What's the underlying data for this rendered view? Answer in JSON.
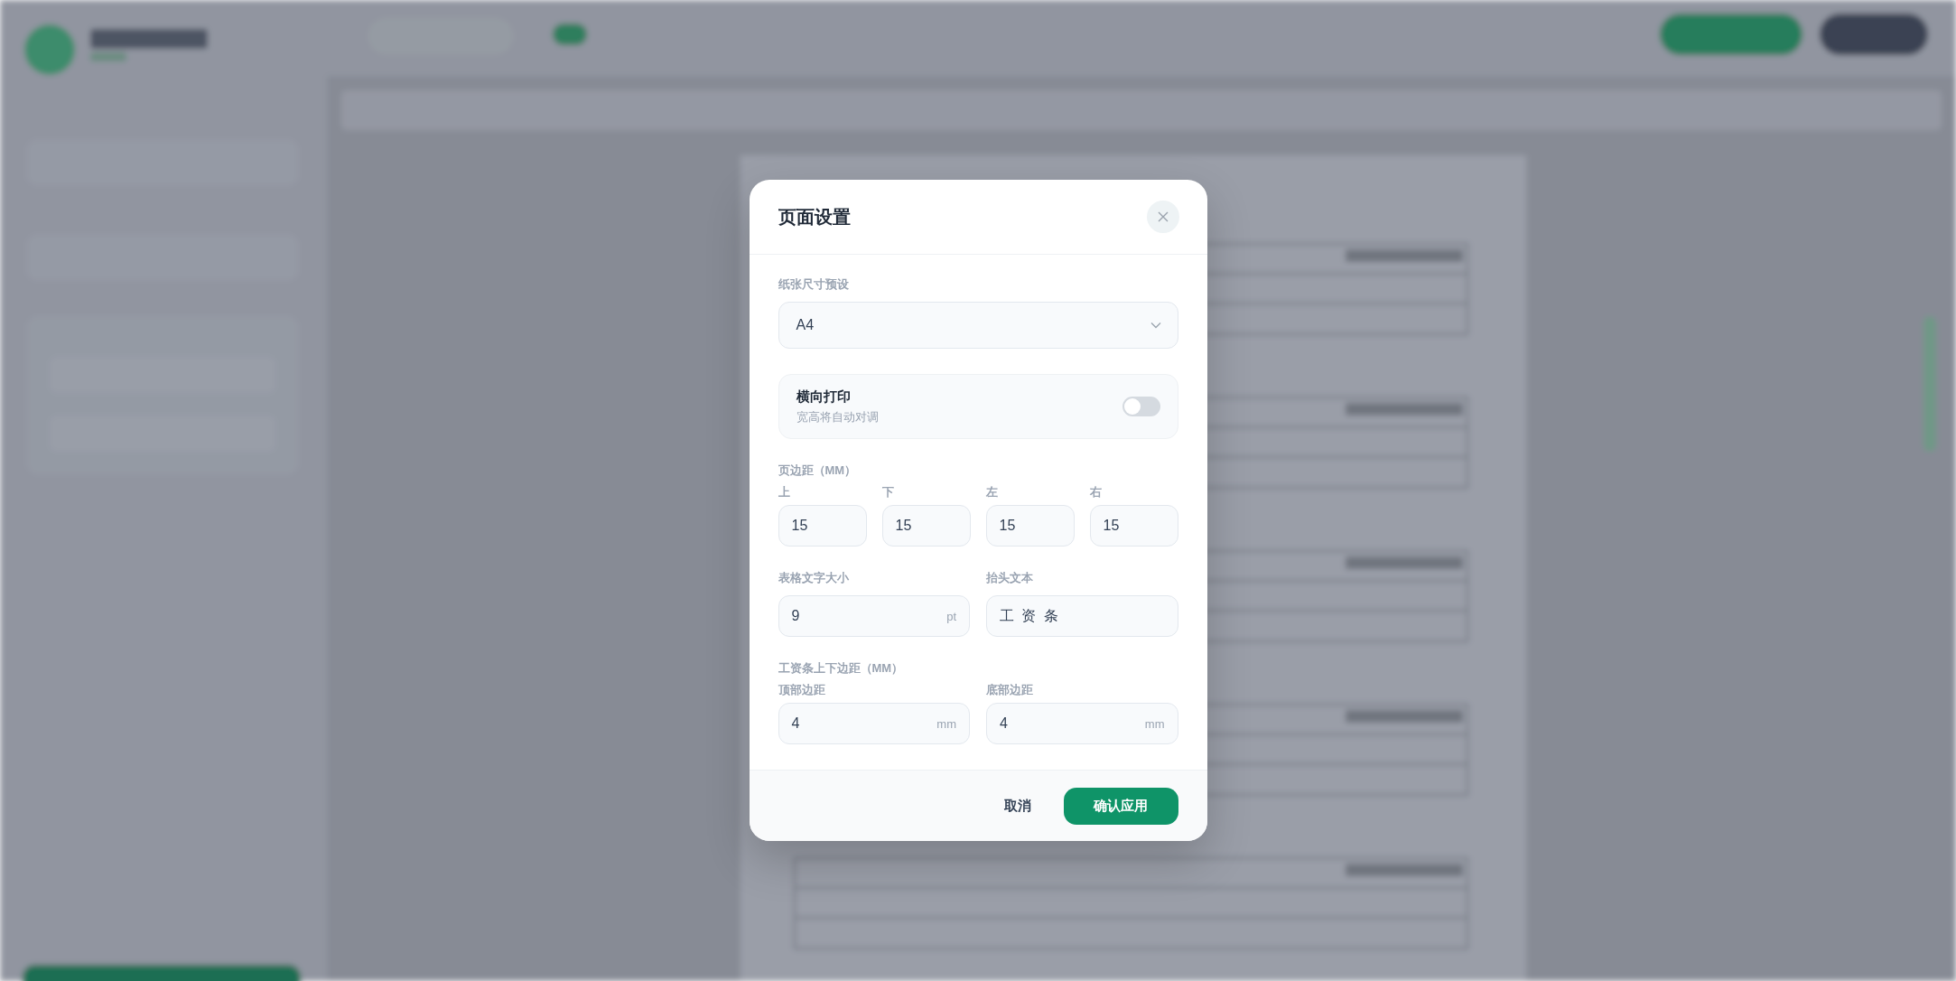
{
  "dialog": {
    "title": "页面设置",
    "paper": {
      "label": "纸张尺寸预设",
      "value": "A4"
    },
    "landscape": {
      "title": "横向打印",
      "hint": "宽高将自动对调",
      "on": false
    },
    "margins": {
      "label": "页边距（MM）",
      "fields": [
        {
          "label": "上",
          "value": "15"
        },
        {
          "label": "下",
          "value": "15"
        },
        {
          "label": "左",
          "value": "15"
        },
        {
          "label": "右",
          "value": "15"
        }
      ]
    },
    "font_size": {
      "label": "表格文字大小",
      "value": "9",
      "unit": "pt"
    },
    "header_text": {
      "label": "抬头文本",
      "value": "工 资 条"
    },
    "slip_margins": {
      "label": "工资条上下边距（MM）",
      "fields": [
        {
          "label": "顶部边距",
          "value": "4",
          "unit": "mm"
        },
        {
          "label": "底部边距",
          "value": "4",
          "unit": "mm"
        }
      ]
    },
    "buttons": [
      {
        "label": "取消",
        "kind": "secondary"
      },
      {
        "label": "确认应用",
        "kind": "primary"
      }
    ]
  }
}
